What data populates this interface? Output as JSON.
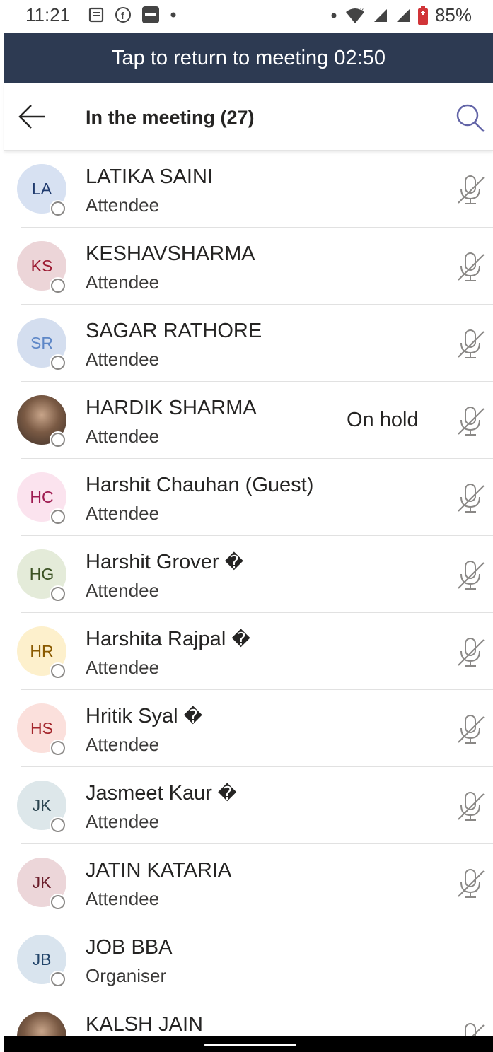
{
  "status_bar": {
    "time": "11:21",
    "battery": "85%",
    "icons": [
      "news-icon",
      "facebook-icon",
      "paytm-icon",
      "dot-icon",
      "dot-icon",
      "wifi-icon",
      "signal-icon",
      "signal-icon",
      "battery-icon"
    ]
  },
  "banner": {
    "text": "Tap to return to meeting 02:50"
  },
  "header": {
    "title": "In the meeting (27)"
  },
  "participants": [
    {
      "initials": "LA",
      "name": "LATIKA SAINI",
      "role": "Attendee",
      "avatar_bg": "#d7e1f2",
      "avatar_fg": "#1f3a6e",
      "muted": true
    },
    {
      "initials": "KS",
      "name": "KESHAVSHARMA",
      "role": "Attendee",
      "avatar_bg": "#ecd5d8",
      "avatar_fg": "#9c1c33",
      "muted": true
    },
    {
      "initials": "SR",
      "name": "SAGAR RATHORE",
      "role": "Attendee",
      "avatar_bg": "#d4deef",
      "avatar_fg": "#5e87c7",
      "muted": true
    },
    {
      "initials": "",
      "name": "HARDIK SHARMA",
      "role": "Attendee",
      "status": "On hold",
      "photo": true,
      "muted": true
    },
    {
      "initials": "HC",
      "name": "Harshit Chauhan (Guest)",
      "role": "Attendee",
      "avatar_bg": "#fbe3ee",
      "avatar_fg": "#9e1a50",
      "muted": true
    },
    {
      "initials": "HG",
      "name": "Harshit Grover",
      "suffix": "�",
      "role": "Attendee",
      "avatar_bg": "#e4ebd9",
      "avatar_fg": "#3b5223",
      "muted": true
    },
    {
      "initials": "HR",
      "name": "Harshita Rajpal",
      "suffix": "�",
      "role": "Attendee",
      "avatar_bg": "#fdf0cc",
      "avatar_fg": "#8a5a00",
      "muted": true
    },
    {
      "initials": "HS",
      "name": "Hritik Syal",
      "suffix": "�",
      "role": "Attendee",
      "avatar_bg": "#fbe0dc",
      "avatar_fg": "#a4262c",
      "muted": true
    },
    {
      "initials": "JK",
      "name": "Jasmeet Kaur",
      "suffix": "�",
      "role": "Attendee",
      "avatar_bg": "#dde7ea",
      "avatar_fg": "#2c4550",
      "muted": true
    },
    {
      "initials": "JK",
      "name": "JATIN KATARIA",
      "role": "Attendee",
      "avatar_bg": "#ecd6d9",
      "avatar_fg": "#6b1e2b",
      "muted": true
    },
    {
      "initials": "JB",
      "name": "JOB BBA",
      "role": "Organiser",
      "avatar_bg": "#d9e4ee",
      "avatar_fg": "#24466b",
      "muted": false
    },
    {
      "initials": "",
      "name": "KALSH JAIN",
      "role": "",
      "photo": true,
      "muted": true
    }
  ]
}
